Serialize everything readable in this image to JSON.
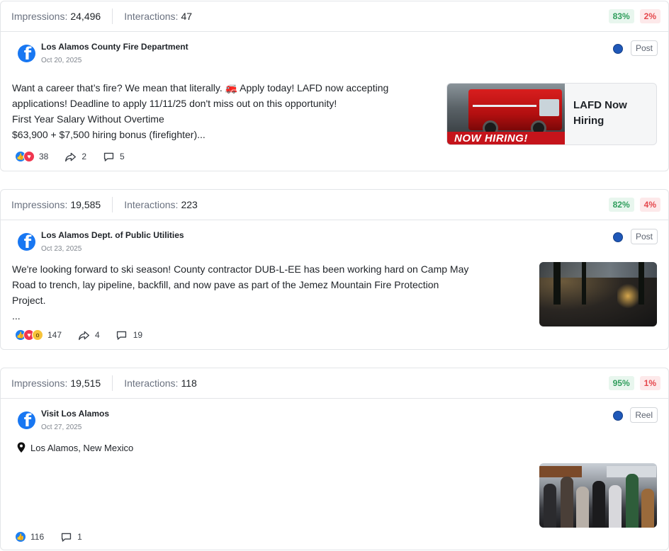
{
  "labels": {
    "impressions": "Impressions:",
    "interactions": "Interactions:"
  },
  "colors": {
    "positive": "#2f9e5c",
    "negative": "#e5484d",
    "facebook": "#1877f2",
    "status_dot": "#1f58b8"
  },
  "posts": [
    {
      "impressions": "24,496",
      "interactions": "47",
      "positive_pct": "83%",
      "negative_pct": "2%",
      "page_name": "Los Alamos County Fire Department",
      "date": "Oct 20, 2025",
      "type": "Post",
      "text_lines": [
        "Want a career that’s fire? We mean that literally. 🚒 Apply today! LAFD now accepting",
        "applications! Deadline to apply 11/11/25 don't miss out on this opportunity!",
        "First Year Salary Without Overtime",
        "$63,900 + $7,500 hiring bonus (firefighter)..."
      ],
      "reactions": "38",
      "shares": "2",
      "comments": "5",
      "link_preview": {
        "image_banner": "NOW HIRING!",
        "title_line1": "LAFD Now",
        "title_line2": "Hiring"
      }
    },
    {
      "impressions": "19,585",
      "interactions": "223",
      "positive_pct": "82%",
      "negative_pct": "4%",
      "page_name": "Los Alamos Dept. of Public Utilities",
      "date": "Oct 23, 2025",
      "type": "Post",
      "text_lines": [
        "We're looking forward to ski season! County contractor DUB-L-EE has been working hard on Camp May",
        "Road to trench, lay pipeline, backfill, and now pave as part of the Jemez Mountain Fire Protection",
        "Project.",
        "..."
      ],
      "reactions": "147",
      "shares": "4",
      "comments": "19"
    },
    {
      "impressions": "19,515",
      "interactions": "118",
      "positive_pct": "95%",
      "negative_pct": "1%",
      "page_name": "Visit Los Alamos",
      "date": "Oct 27, 2025",
      "type": "Reel",
      "location": "Los Alamos, New Mexico",
      "reactions": "116",
      "comments": "1"
    }
  ]
}
